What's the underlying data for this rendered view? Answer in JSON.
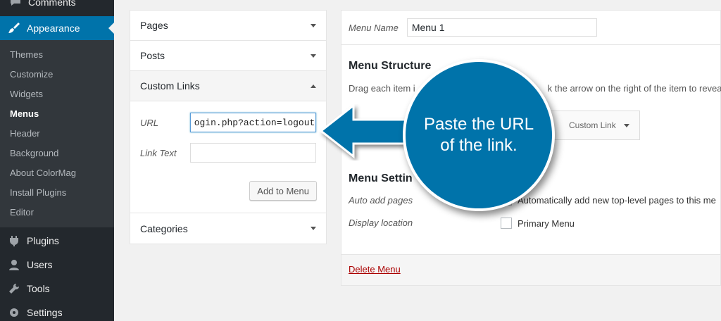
{
  "sidebar": {
    "top_item": "Comments",
    "active": "Appearance",
    "sub_items": [
      "Themes",
      "Customize",
      "Widgets",
      "Menus",
      "Header",
      "Background",
      "About ColorMag",
      "Install Plugins",
      "Editor"
    ],
    "lower_items": [
      "Plugins",
      "Users",
      "Tools",
      "Settings"
    ]
  },
  "accordion": {
    "pages": "Pages",
    "posts": "Posts",
    "custom_links": "Custom Links",
    "url_label": "URL",
    "url_value": "ogin.php?action=logout",
    "link_text_label": "Link Text",
    "link_text_value": "",
    "add_button": "Add to Menu",
    "categories": "Categories"
  },
  "menu_editor": {
    "name_label": "Menu Name",
    "name_value": "Menu 1",
    "structure_title": "Menu Structure",
    "structure_desc_a": "Drag each item i",
    "structure_desc_b": "k the arrow on the right of the item to reveal a",
    "item_type": "Custom Link",
    "settings_title": "Menu Settin",
    "auto_add_label": "Auto add pages",
    "auto_add_text": "Automatically add new top-level pages to this me",
    "display_location_label": "Display location",
    "primary_menu": "Primary Menu",
    "delete": "Delete Menu"
  },
  "callout": {
    "line1": "Paste the URL",
    "line2": "of the link."
  },
  "colors": {
    "sidebar_bg": "#23282d",
    "accent": "#0073aa",
    "delete_red": "#a00"
  }
}
